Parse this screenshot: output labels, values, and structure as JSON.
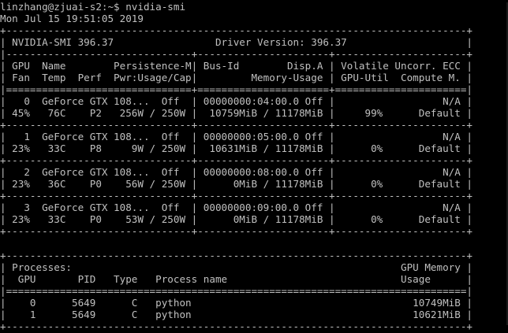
{
  "terminal": {
    "prompt_line": "linzhang@zjuai-s2:~$ nvidia-smi",
    "timestamp_line": "Mon Jul 15 19:51:05 2019",
    "header": {
      "border_top": "+-----------------------------------------------------------------------------+",
      "version_line": "| NVIDIA-SMI 396.37                 Driver Version: 396.37                    |",
      "border_mid": "|-------------------------------+----------------------+----------------------+",
      "col_header_1": "| GPU  Name        Persistence-M| Bus-Id        Disp.A | Volatile Uncorr. ECC |",
      "col_header_2": "| Fan  Temp  Perf  Pwr:Usage/Cap|         Memory-Usage | GPU-Util  Compute M. |",
      "border_double": "|===============================+======================+======================|"
    },
    "gpus": [
      {
        "row1": "|   0  GeForce GTX 108...  Off  | 00000000:04:00.0 Off |                  N/A |",
        "row2": "| 45%   76C    P2   256W / 250W |  10759MiB / 11178MiB |     99%      Default |",
        "separator": "+-------------------------------+----------------------+----------------------+"
      },
      {
        "row1": "|   1  GeForce GTX 108...  Off  | 00000000:05:00.0 Off |                  N/A |",
        "row2": "| 23%   33C    P8     9W / 250W |  10631MiB / 11178MiB |      0%      Default |",
        "separator": "+-------------------------------+----------------------+----------------------+"
      },
      {
        "row1": "|   2  GeForce GTX 108...  Off  | 00000000:08:00.0 Off |                  N/A |",
        "row2": "| 23%   36C    P0    56W / 250W |      0MiB / 11178MiB |      0%      Default |",
        "separator": "+-------------------------------+----------------------+----------------------+"
      },
      {
        "row1": "|   3  GeForce GTX 108...  Off  | 00000000:09:00.0 Off |                  N/A |",
        "row2": "| 23%   33C    P0    53W / 250W |      0MiB / 11178MiB |      0%      Default |",
        "separator": "+-------------------------------+----------------------+----------------------+"
      }
    ],
    "processes": {
      "border_top": "+-----------------------------------------------------------------------------+",
      "title_line": "| Processes:                                                       GPU Memory |",
      "header_line": "|  GPU       PID   Type   Process name                             Usage      |",
      "border_double": "|=============================================================================|",
      "rows": [
        "|    0      5649      C   python                                     10749MiB |",
        "|    1      5649      C   python                                     10621MiB |"
      ],
      "border_bottom": "+-----------------------------------------------------------------------------+"
    }
  }
}
